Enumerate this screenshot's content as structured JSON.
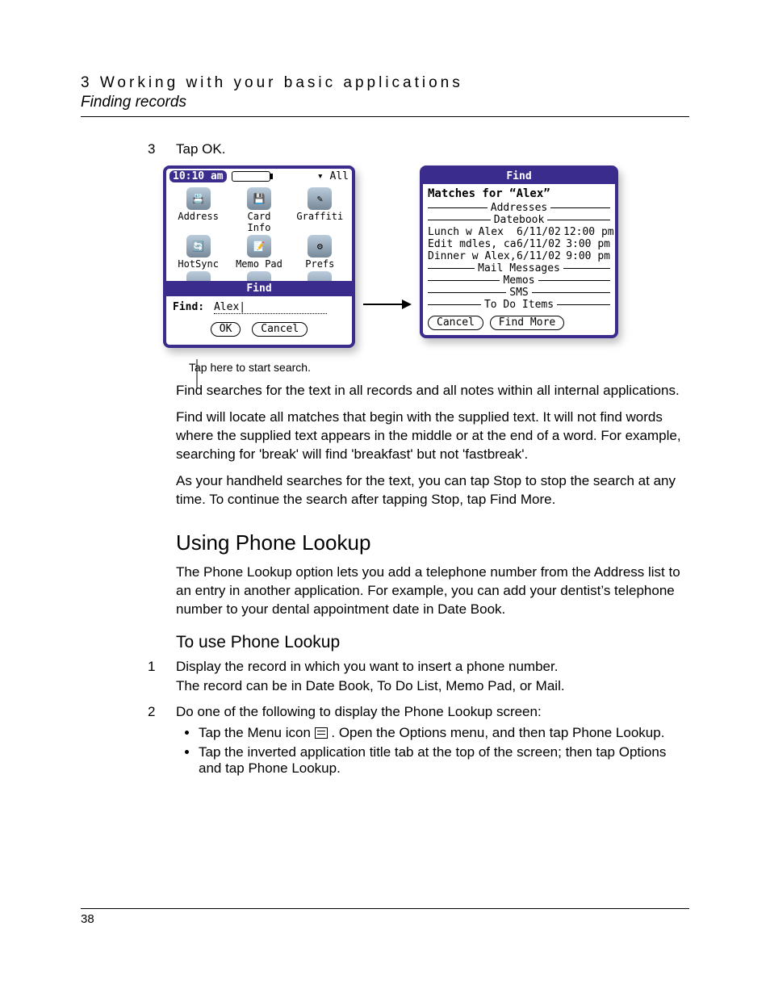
{
  "header": {
    "chapter": "3 Working with your basic applications",
    "section": "Finding records"
  },
  "step3": {
    "num": "3",
    "text": "Tap OK."
  },
  "palm_left": {
    "time": "10:10 am",
    "category": "▾ All",
    "apps_row1": [
      "Address",
      "Card Info",
      "Graffiti"
    ],
    "apps_row2": [
      "HotSync",
      "Memo Pad",
      "Prefs"
    ],
    "find_bar_title": "Find",
    "find_label": "Find:",
    "find_value": "Alex",
    "ok": "OK",
    "cancel": "Cancel"
  },
  "callout": "Tap here to start search.",
  "palm_right": {
    "title": "Find",
    "matches_for": "Matches for “Alex”",
    "cat_addresses": "Addresses",
    "cat_datebook": "Datebook",
    "rows": [
      {
        "c1": "Lunch w Alex",
        "c2": "6/11/02",
        "c3": "12:00 pm"
      },
      {
        "c1": "Edit mdles, call …",
        "c2": "6/11/02",
        "c3": "3:00 pm"
      },
      {
        "c1": "Dinner w Alex, …",
        "c2": "6/11/02",
        "c3": "9:00 pm"
      }
    ],
    "cat_mail": "Mail Messages",
    "cat_memos": "Memos",
    "cat_sms": "SMS",
    "cat_todo": "To Do Items",
    "cancel": "Cancel",
    "find_more": "Find More"
  },
  "paras": {
    "p1": "Find searches for the text in all records and all notes within all internal applications.",
    "p2": "Find will locate all matches that begin with the supplied text. It will not find words where the supplied text appears in the middle or at the end of a word. For example, searching for 'break' will find 'breakfast' but not 'fastbreak'.",
    "p3": "As your handheld searches for the text, you can tap Stop to stop the search at any time. To continue the search after tapping Stop, tap Find More."
  },
  "phone_lookup": {
    "title": "Using Phone Lookup",
    "intro": "The Phone Lookup option lets you add a telephone number from the Address list to an entry in another application. For example, you can add your dentist’s telephone number to your dental appointment date in Date Book.",
    "subtitle": "To use Phone Lookup",
    "s1_num": "1",
    "s1": "Display the record in which you want to insert a phone number.",
    "s1b": "The record can be in Date Book, To Do List, Memo Pad, or Mail.",
    "s2_num": "2",
    "s2": "Do one of the following to display the Phone Lookup screen:",
    "b1a": "Tap the Menu icon ",
    "b1b": ". Open the Options menu, and then tap Phone Lookup.",
    "b2": "Tap the inverted application title tab at the top of the screen; then tap Options and tap Phone Lookup."
  },
  "page_number": "38"
}
